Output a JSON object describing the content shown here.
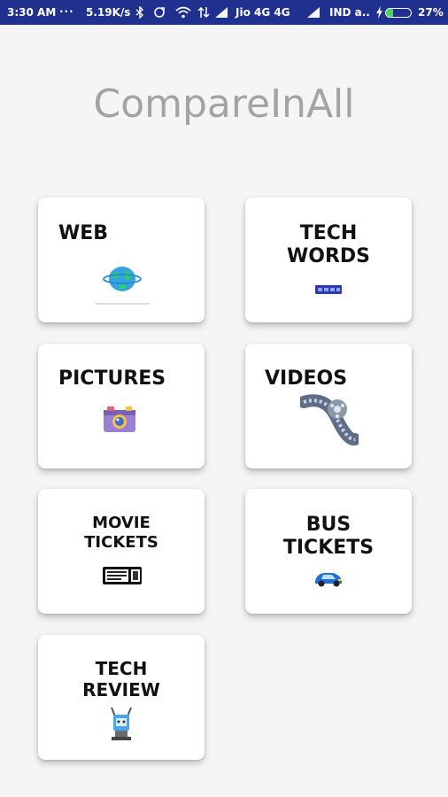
{
  "status_bar": {
    "time": "3:30 AM",
    "dots": "...",
    "speed": "5.19K/s",
    "carrier1": "Jio 4G 4G",
    "carrier2": "IND a..",
    "battery_percent": "27%",
    "battery_level": 0.27,
    "icons": [
      "bluetooth-icon",
      "sync-icon",
      "wifi-icon",
      "data-icon",
      "signal-icon",
      "signal-icon",
      "charging-icon",
      "battery-icon"
    ]
  },
  "app": {
    "title": "CompareInAll"
  },
  "cards": {
    "web": {
      "label": "WEB",
      "icon": "globe-icon"
    },
    "tech_words": {
      "label": "TECH\nWORDS",
      "icon": "tech-words-icon"
    },
    "pictures": {
      "label": "PICTURES",
      "icon": "camera-icon"
    },
    "videos": {
      "label": "VIDEOS",
      "icon": "film-reel-icon"
    },
    "movie_tickets": {
      "label": "MOVIE\nTICKETS",
      "icon": "movie-ticket-icon"
    },
    "bus_tickets": {
      "label": "BUS\nTICKETS",
      "icon": "car-icon"
    },
    "tech_review": {
      "label": "TECH\nREVIEW",
      "icon": "robot-icon"
    }
  },
  "colors": {
    "status_bar": "#20308f",
    "background": "#f5f5f5",
    "title": "#a3a3a3",
    "battery": "#4cd15a"
  }
}
